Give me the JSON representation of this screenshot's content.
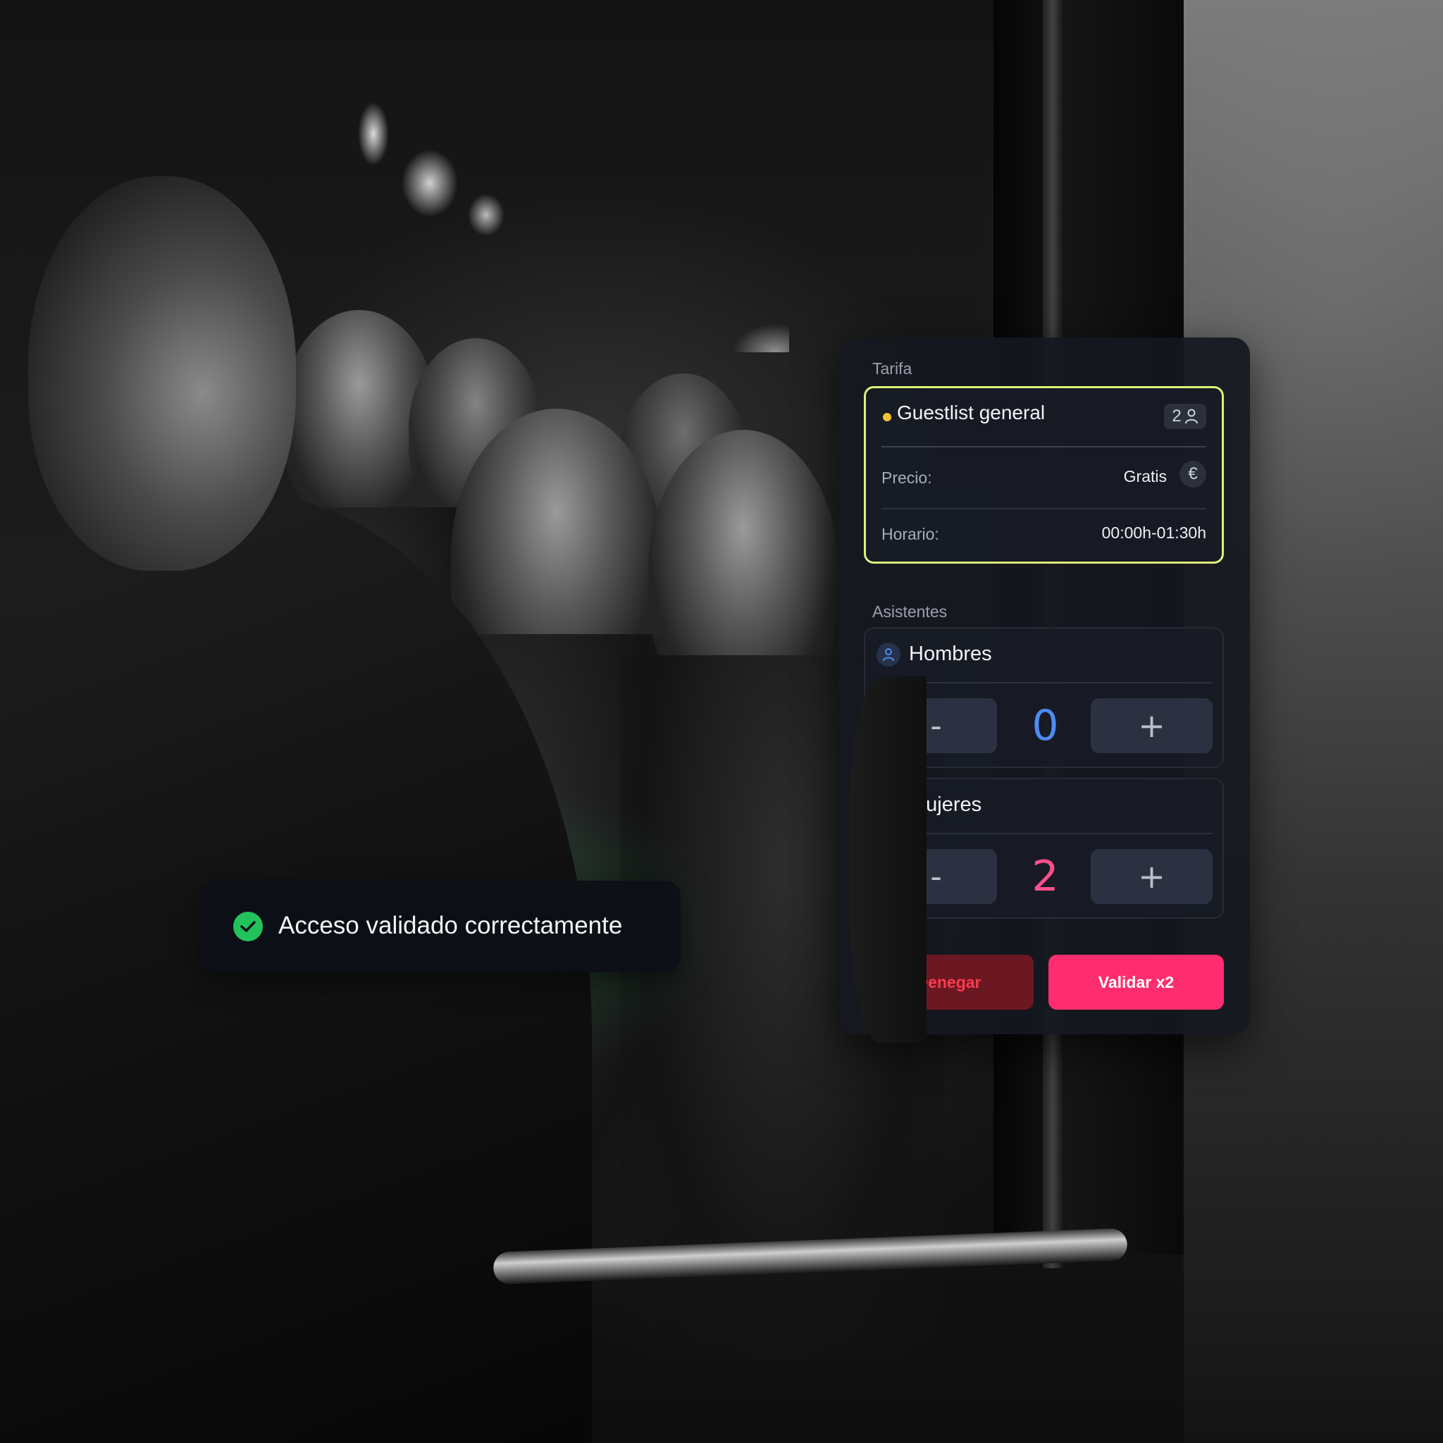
{
  "tarifa": {
    "label": "Tarifa",
    "name": "Guestlist general",
    "count": "2",
    "precio_label": "Precio:",
    "precio_value": "Gratis",
    "horario_label": "Horario:",
    "horario_value": "00:00h-01:30h"
  },
  "asistentes": {
    "label": "Asistentes",
    "groups": [
      {
        "name": "Hombres",
        "value": "0",
        "minus": "-",
        "plus": "+"
      },
      {
        "name": "Mujeres",
        "value": "2",
        "minus": "-",
        "plus": "+"
      }
    ]
  },
  "actions": {
    "deny_label": "Denegar",
    "validate_label": "Validar x2"
  },
  "toast": {
    "message": "Acceso validado correctamente"
  },
  "icons": {
    "status_dot": "dot-icon",
    "people": "person-icon",
    "price": "euro-icon",
    "success": "check-circle-icon"
  },
  "colors": {
    "accent_border": "#dff07a",
    "status_dot": "#f2c230",
    "hombres_value": "#4f8bf5",
    "mujeres_value": "#ff4f8b",
    "validate": "#ff2d6f",
    "deny_text": "#ff3b4e",
    "success": "#22c35a"
  }
}
